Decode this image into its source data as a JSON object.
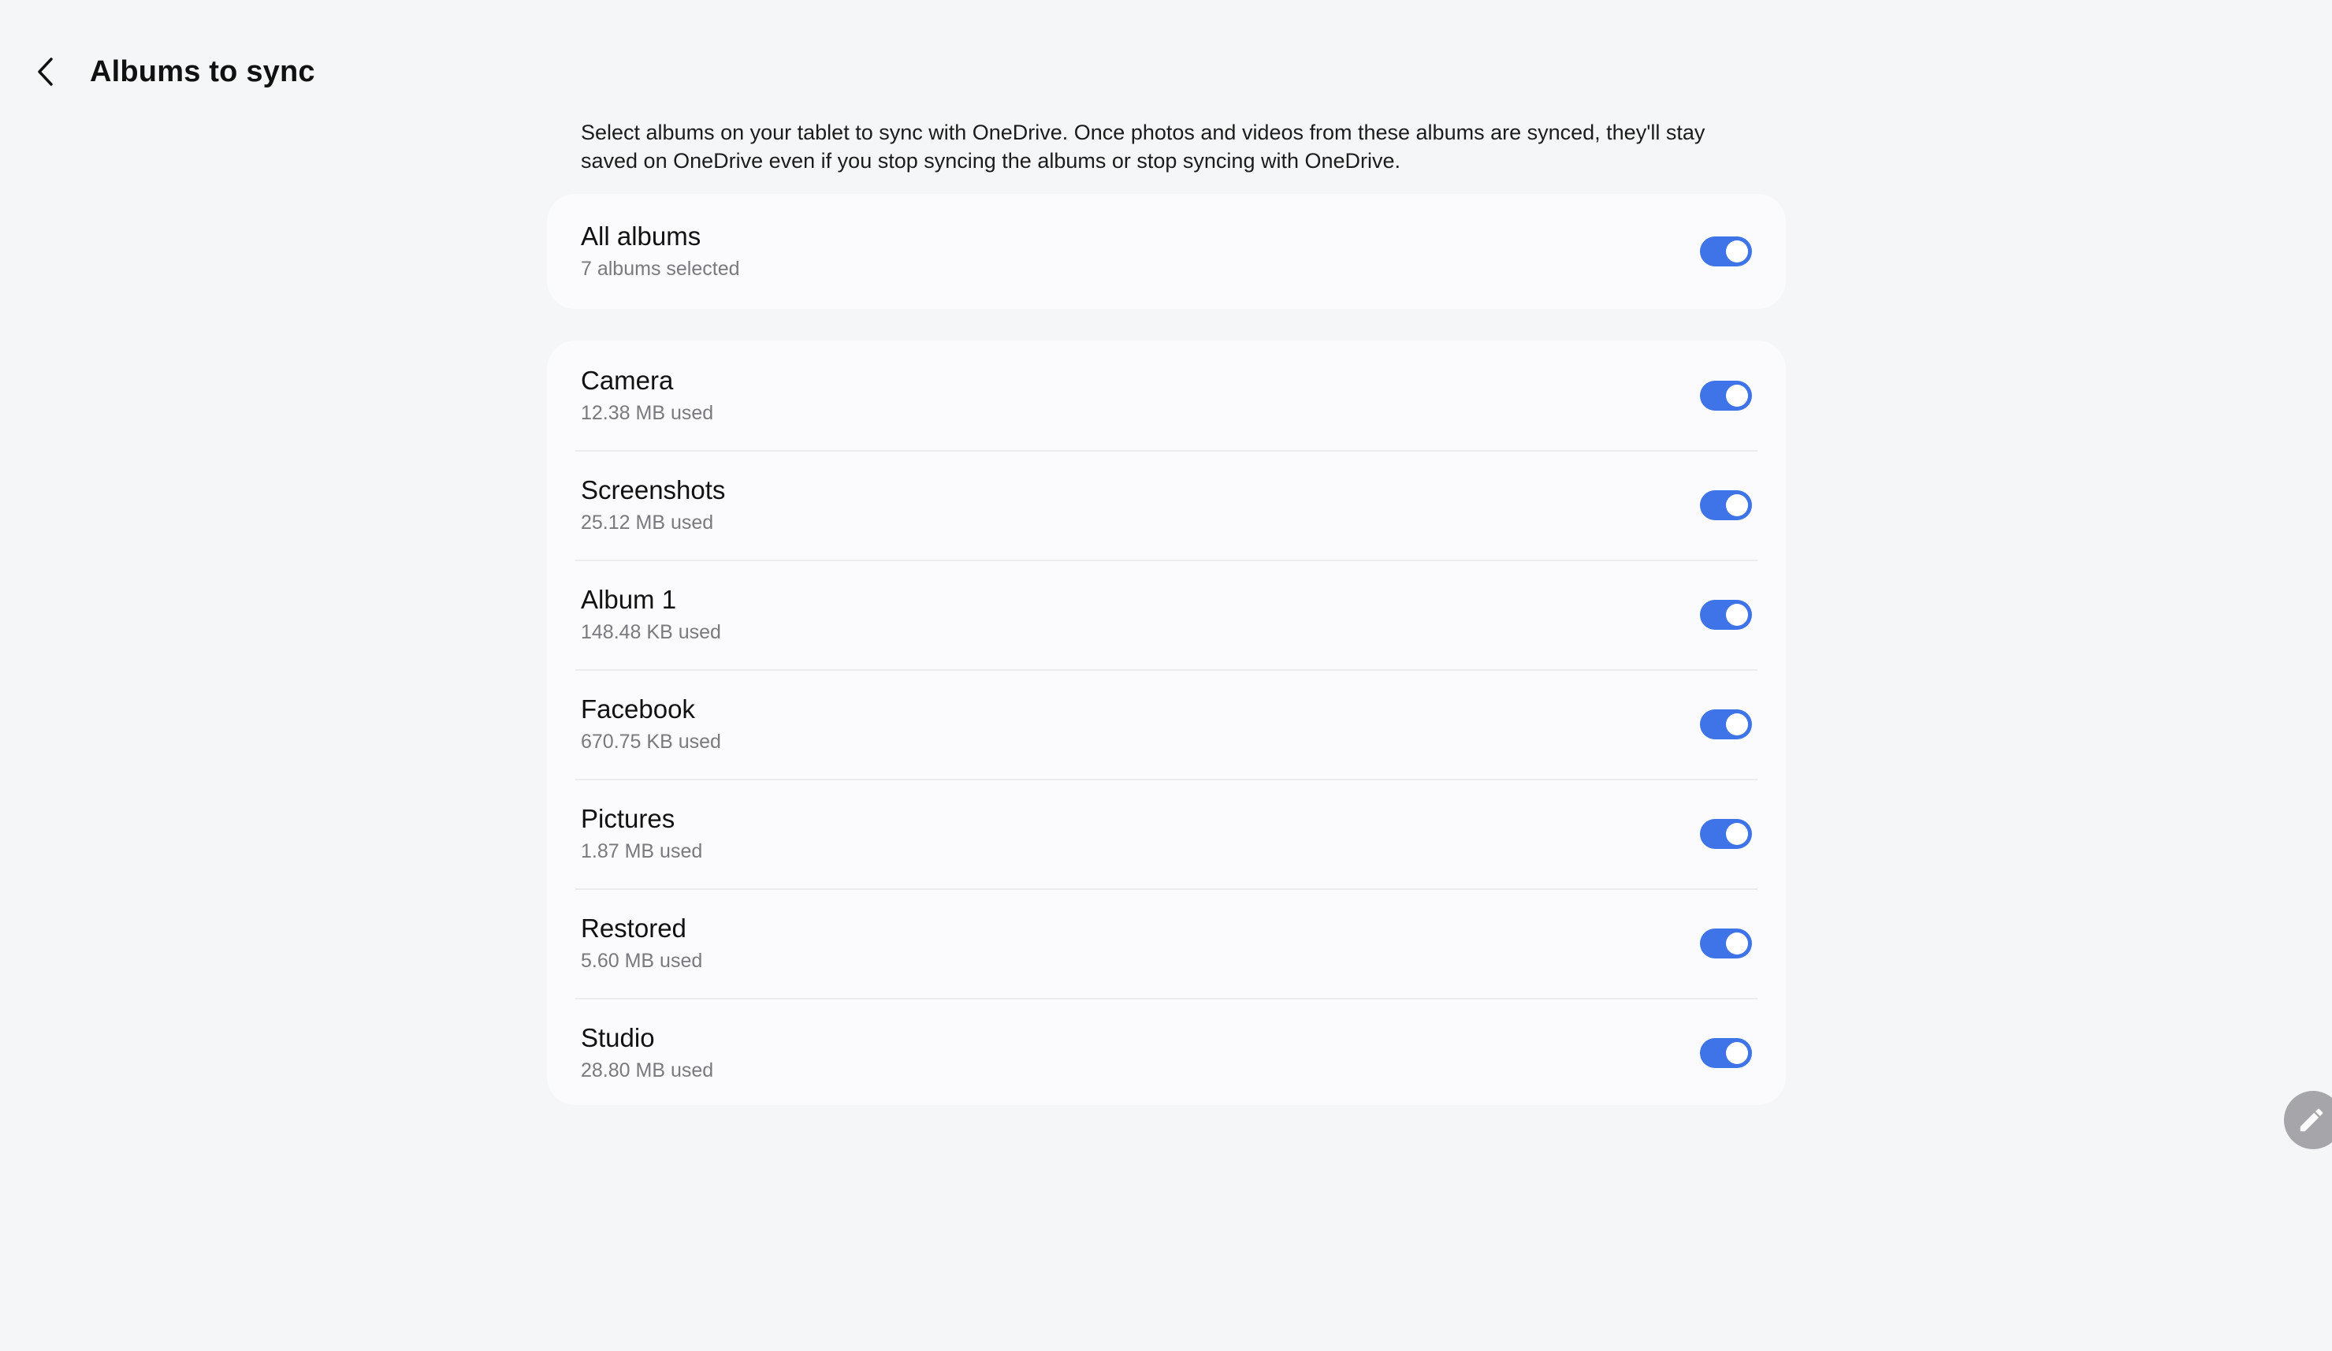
{
  "header": {
    "title": "Albums to sync",
    "back_icon": "chevron-left-icon"
  },
  "description": "Select albums on your tablet to sync with OneDrive. Once photos and videos from these albums are synced, they'll stay saved on OneDrive even if you stop syncing the albums or stop syncing with OneDrive.",
  "all_albums": {
    "title": "All albums",
    "subtitle": "7 albums selected",
    "enabled": true
  },
  "albums": [
    {
      "title": "Camera",
      "subtitle": "12.38 MB used",
      "enabled": true
    },
    {
      "title": "Screenshots",
      "subtitle": "25.12 MB used",
      "enabled": true
    },
    {
      "title": "Album 1",
      "subtitle": "148.48 KB used",
      "enabled": true
    },
    {
      "title": "Facebook",
      "subtitle": "670.75 KB used",
      "enabled": true
    },
    {
      "title": "Pictures",
      "subtitle": "1.87 MB used",
      "enabled": true
    },
    {
      "title": "Restored",
      "subtitle": "5.60 MB used",
      "enabled": true
    },
    {
      "title": "Studio",
      "subtitle": "28.80 MB used",
      "enabled": true
    }
  ],
  "colors": {
    "background": "#f5f6f8",
    "card": "#fbfbfd",
    "toggle_on": "#3e74e8",
    "fab": "#a6a6aa"
  },
  "fab_icon": "pencil-icon"
}
